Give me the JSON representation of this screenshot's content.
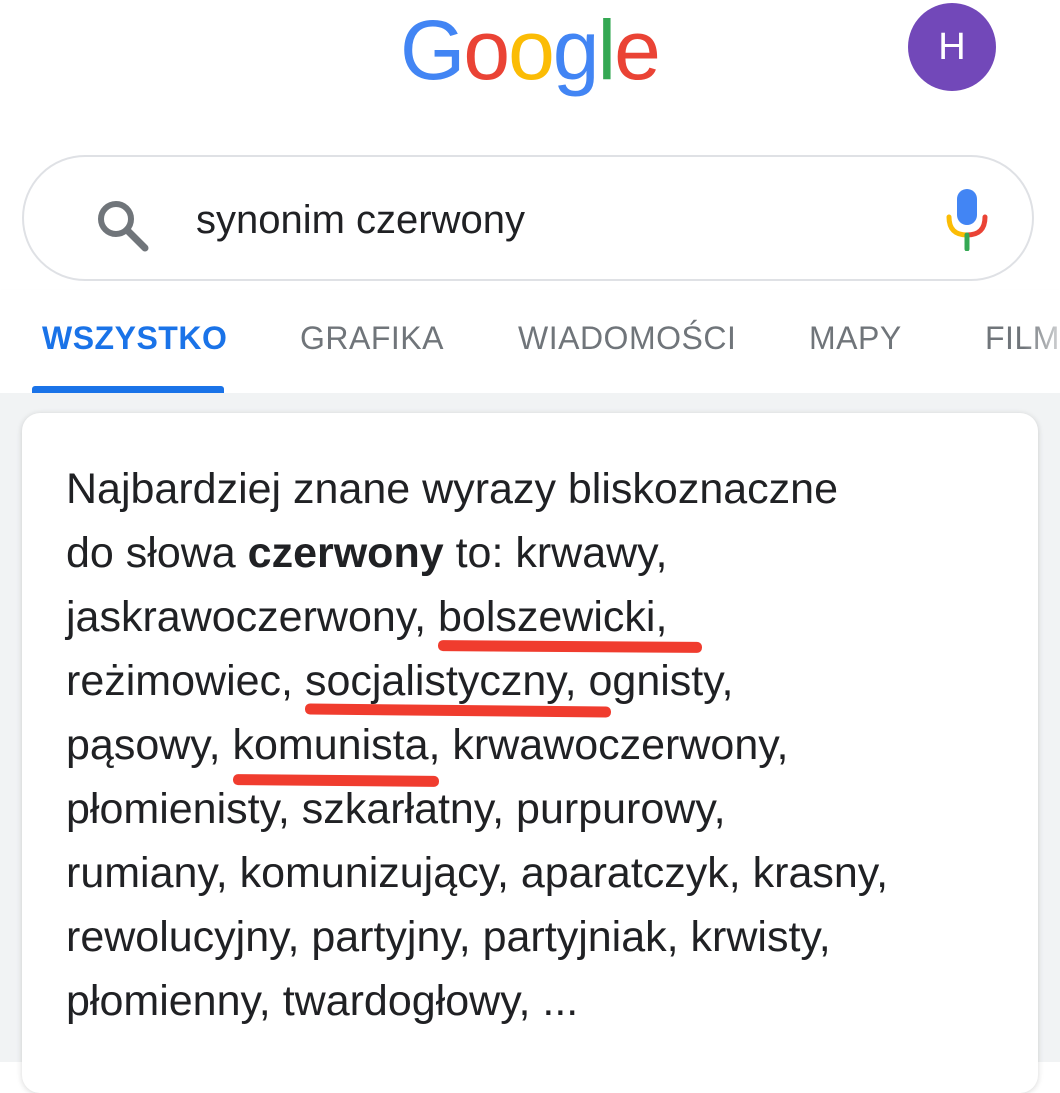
{
  "header": {
    "logo": [
      "G",
      "o",
      "o",
      "g",
      "l",
      "e"
    ],
    "logo_colors": [
      "#4285f4",
      "#ea4335",
      "#fbbc05",
      "#4285f4",
      "#34a853",
      "#ea4335"
    ],
    "avatar_initial": "H",
    "avatar_color": "#7248b9"
  },
  "search": {
    "query": "synonim czerwony",
    "search_icon": "search-icon",
    "mic_icon": "mic-icon"
  },
  "tabs": {
    "items": [
      {
        "label": "WSZYSTKO",
        "active": true
      },
      {
        "label": "GRAFIKA",
        "active": false
      },
      {
        "label": "WIADOMOŚCI",
        "active": false
      },
      {
        "label": "MAPY",
        "active": false
      },
      {
        "label": "FILMY",
        "active": false
      }
    ],
    "active_color": "#1a73e8"
  },
  "answer": {
    "line1": "Najbardziej znane wyrazy bliskoznaczne",
    "line2_prefix": "do słowa ",
    "line2_bold": "czerwony",
    "line2_suffix": " to: krwawy,",
    "line3_prefix": "jaskrawoczerwony, ",
    "line3_marked": "bolszewicki,",
    "line4_prefix": "reżimowiec, ",
    "line4_marked": "socjalistyczny,",
    "line4_suffix": " ognisty,",
    "line5_prefix": "pąsowy, ",
    "line5_marked": "komunista",
    "line5_suffix": ", krwawoczerwony,",
    "line6": "płomienisty, szkarłatny, purpurowy,",
    "line7": "rumiany, komunizujący, aparatczyk, krasny,",
    "line8": "rewolucyjny, partyjny, partyjniak, krwisty,",
    "line9": "płomienny, twardogłowy, ...",
    "highlight_color": "#f03c2e"
  }
}
